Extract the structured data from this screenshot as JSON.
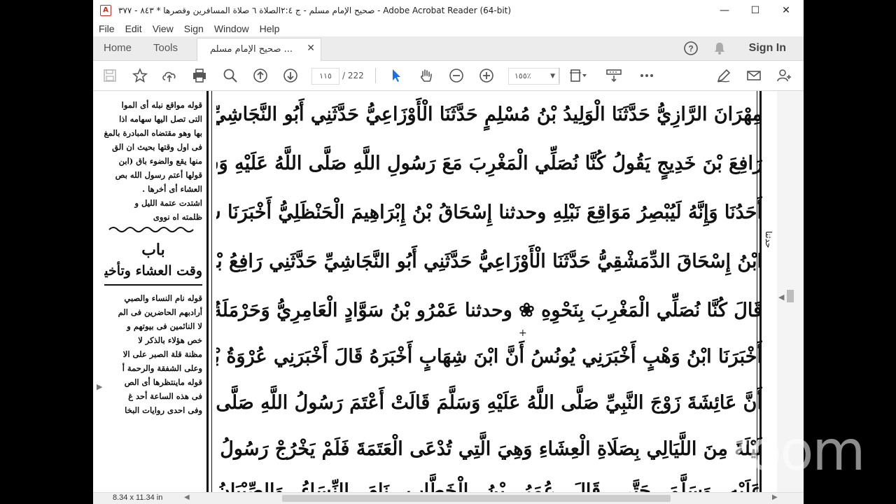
{
  "window": {
    "title": "صحيح الإمام مسلم - ج ٢:٤الصلاة ٦ صلاة المسافرين وقصرها * ٨٤٣ - ٣٧٧ - Adobe Acrobat Reader (64-bit)",
    "minimize_glyph": "—",
    "maximize_glyph": "☐",
    "close_glyph": "✕"
  },
  "menu": [
    "File",
    "Edit",
    "View",
    "Sign",
    "Window",
    "Help"
  ],
  "tabs": {
    "home": "Home",
    "tools": "Tools",
    "document": "صحيح الإمام مسلم ...",
    "close_glyph": "✕"
  },
  "header": {
    "help_glyph": "?",
    "sign_in": "Sign In"
  },
  "toolbar": {
    "page_current": "١١٥",
    "page_total": "/ 222",
    "zoom": "١٥٥٪"
  },
  "document": {
    "size": "8.34 x 11.34 in",
    "margin_lines": [
      "قوله مواقع نبله أى الموا",
      "التى تصل اليها سهامه اذا",
      "بها وهو مقتضاه المبادرة بالمغ",
      "فى اول وقتها بحيث ان الق",
      "منها يقع والضوء باق (ابن",
      "قولها أعتم رسول الله بص",
      "العشاء أى أخرها .",
      "اشتدت عتمة الليل و",
      "ظلمته اه نووى",
      "باب",
      "وقت العشاء وتأخير",
      "قوله نام النساء والصبي",
      "أرادبهم الحاضرين فى الم",
      "لا النائمين فى بيوتهم و",
      "خص هؤلاء بالذكر لا",
      "مظنة قلة الصبر على الا",
      "وعلى الشفقة والرحمة أ",
      "قوله ماينتظرها أى الص",
      "فى هذه الساعة أحد غ",
      "وفى احدى روايات البخا"
    ],
    "main_lines": [
      "مِهْرَانَ الرَّازِيُّ حَدَّثَنَا الْوَلِيدُ بْنُ مُسْلِمٍ حَدَّثَنَا الْأَوْزَاعِيُّ حَدَّثَنِي أَبُو النَّجَاشِيِّ قَالَ سَمِعْتُ",
      "رَافِعَ بْنَ خَدِيجٍ يَقُولُ كُنَّا نُصَلِّي الْمَغْرِبَ مَعَ رَسُولِ اللَّهِ صَلَّى اللَّهُ عَلَيْهِ وَسَلَّمَ فَيَنْصَرِفُ",
      "أَحَدُنَا وَإِنَّهُ لَيُبْصِرُ مَوَاقِعَ نَبْلِهِ وحدثنا إِسْحَاقُ بْنُ إِبْرَاهِيمَ الْحَنْظَلِيُّ أَخْبَرَنَا شُعَيْبُ",
      "ابْنُ إِسْحَاقَ الدِّمَشْقِيُّ حَدَّثَنَا الْأَوْزَاعِيُّ حَدَّثَنِي أَبُو النَّجَاشِيِّ حَدَّثَنِي رَافِعُ بْنُ خَدِيجٍ",
      "قَالَ كُنَّا نُصَلِّي الْمَغْرِبَ بِنَحْوِهِ ❀ وحدثنا عَمْرُو بْنُ سَوَّادٍ الْعَامِرِيُّ وَحَرْمَلَةُ بْنُ يَحْيَى قَالَا",
      "أَخْبَرَنَا ابْنُ وَهْبٍ أَخْبَرَنِي يُونُسُ أَنَّ ابْنَ شِهَابٍ أَخْبَرَهُ قَالَ أَخْبَرَنِي عُرْوَةُ بْنُ الزُّبَيْرِ",
      "أَنَّ عَائِشَةَ زَوْجَ النَّبِيِّ صَلَّى اللَّهُ عَلَيْهِ وَسَلَّمَ قَالَتْ أَعْتَمَ رَسُولُ اللَّهِ صَلَّى اللَّهُ عَلَيْهِ وَسَلَّمَ",
      "لَيْلَةً مِنَ اللَّيَالِي بِصَلَاةِ الْعِشَاءِ وَهِيَ الَّتِي تُدْعَى الْعَتَمَةَ فَلَمْ يَخْرُجْ رَسُولُ اللَّهِ صَلَّى اللَّهُ",
      "عَلَيْهِ وَسَلَّمَ حَتَّى قَالَ عُمَرُ بْنُ الْخَطَّابِ نَامَ النِّسَاءُ وَالصِّبْيَانُ"
    ],
    "right_strip": "حدثنا"
  },
  "overlay": {
    "watermark": "zoom"
  },
  "colors": {
    "acrobat_red": "#d0291c",
    "select_blue": "#1473e6"
  }
}
